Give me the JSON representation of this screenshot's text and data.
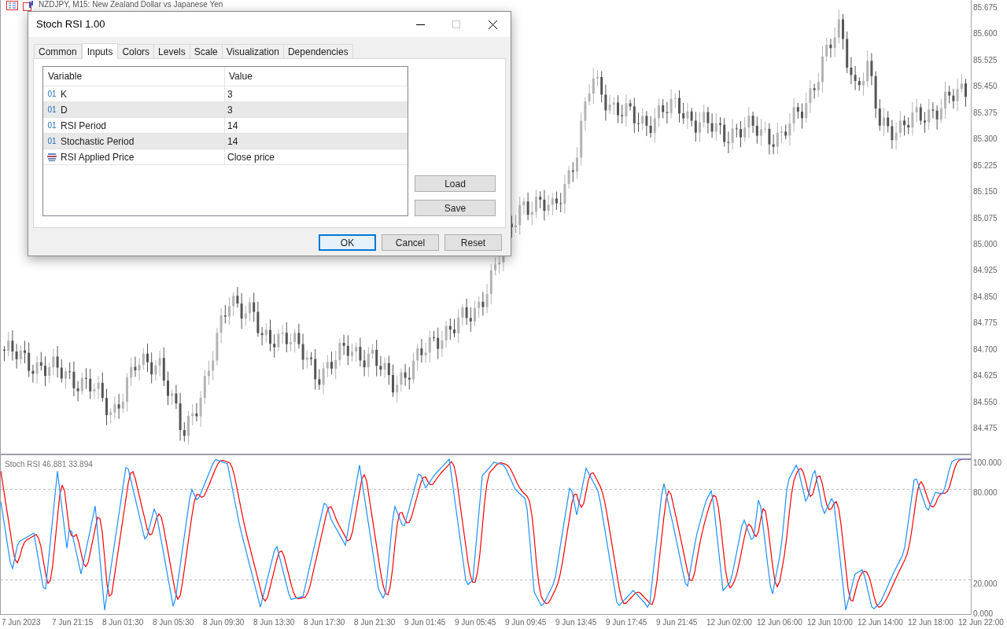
{
  "chart_window": {
    "title": "NZDJPY, M15: New Zealand Dollar vs Japanese Yen"
  },
  "price_axis": [
    "85.675",
    "85.600",
    "85.525",
    "85.450",
    "85.375",
    "85.300",
    "85.225",
    "85.150",
    "85.075",
    "85.000",
    "84.925",
    "84.850",
    "84.775",
    "84.700",
    "84.625",
    "84.550",
    "84.475"
  ],
  "indicator": {
    "label": "Stoch RSI 46.881 33.894",
    "axis": [
      "100.000",
      "80.000",
      "20.000",
      "0.000"
    ]
  },
  "time_axis": [
    "7 Jun 2023",
    "7 Jun 21:15",
    "8 Jun 01:30",
    "8 Jun 05:30",
    "8 Jun 09:30",
    "8 Jun 13:30",
    "8 Jun 17:30",
    "8 Jun 21:30",
    "9 Jun 01:45",
    "9 Jun 05:45",
    "9 Jun 09:45",
    "9 Jun 13:45",
    "9 Jun 17:45",
    "9 Jun 21:45",
    "12 Jun 02:00",
    "12 Jun 06:00",
    "12 Jun 10:00",
    "12 Jun 14:00",
    "12 Jun 18:00",
    "12 Jun 22:00"
  ],
  "dialog": {
    "title": "Stoch RSI 1.00",
    "tabs": [
      {
        "label": "Common",
        "selected": false
      },
      {
        "label": "Inputs",
        "selected": true
      },
      {
        "label": "Colors",
        "selected": false
      },
      {
        "label": "Levels",
        "selected": false
      },
      {
        "label": "Scale",
        "selected": false
      },
      {
        "label": "Visualization",
        "selected": false
      },
      {
        "label": "Dependencies",
        "selected": false
      }
    ],
    "table": {
      "columns": [
        "Variable",
        "Value"
      ],
      "rows": [
        {
          "kind": "integer",
          "icon_text": "01",
          "variable": "K",
          "value": "3"
        },
        {
          "kind": "integer",
          "icon_text": "01",
          "variable": "D",
          "value": "3"
        },
        {
          "kind": "integer",
          "icon_text": "01",
          "variable": "RSI Period",
          "value": "14"
        },
        {
          "kind": "integer",
          "icon_text": "01",
          "variable": "Stochastic Period",
          "value": "14"
        },
        {
          "kind": "enum",
          "variable": "RSI Applied Price",
          "value": "Close price"
        }
      ]
    },
    "side_buttons": [
      "Load",
      "Save"
    ],
    "buttons": [
      {
        "label": "OK",
        "default": true
      },
      {
        "label": "Cancel",
        "default": false
      },
      {
        "label": "Reset",
        "default": false
      }
    ]
  }
}
